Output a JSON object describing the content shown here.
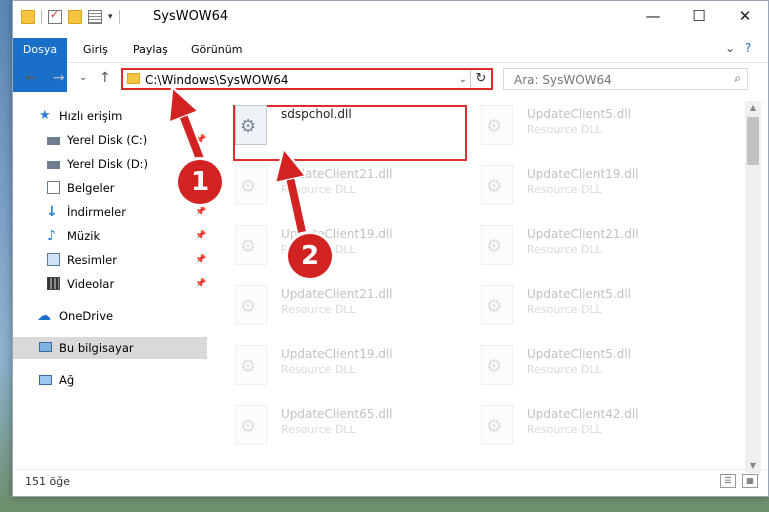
{
  "window": {
    "title": "SysWOW64"
  },
  "window_buttons": {
    "minimize": "—",
    "maximize": "☐",
    "close": "✕"
  },
  "ribbon": {
    "tabs": [
      "Dosya",
      "Giriş",
      "Paylaş",
      "Görünüm"
    ],
    "collapse_glyph": "⌄",
    "help_glyph": "?"
  },
  "navigation": {
    "back": "←",
    "forward": "→",
    "recent": "⌄",
    "up": "↑",
    "address": "C:\\Windows\\SysWOW64",
    "address_dropdown": "⌄",
    "refresh": "↻",
    "search_placeholder": "Ara: SysWOW64",
    "search_icon": "⌕"
  },
  "sidebar": {
    "items": [
      {
        "label": "Hızlı erişim",
        "icon": "star-icon",
        "pinned": false
      },
      {
        "label": "Yerel Disk (C:)",
        "icon": "drive-icon",
        "pinned": true
      },
      {
        "label": "Yerel Disk (D:)",
        "icon": "drive-icon",
        "pinned": false
      },
      {
        "label": "Belgeler",
        "icon": "documents-icon",
        "pinned": false
      },
      {
        "label": "İndirmeler",
        "icon": "download-icon",
        "pinned": true
      },
      {
        "label": "Müzik",
        "icon": "music-icon",
        "pinned": true
      },
      {
        "label": "Resimler",
        "icon": "pictures-icon",
        "pinned": true
      },
      {
        "label": "Videolar",
        "icon": "videos-icon",
        "pinned": true
      },
      {
        "label": "OneDrive",
        "icon": "cloud-icon",
        "pinned": false
      },
      {
        "label": "Bu bilgisayar",
        "icon": "computer-icon",
        "pinned": false,
        "selected": true
      },
      {
        "label": "Ağ",
        "icon": "network-icon",
        "pinned": false
      }
    ],
    "pin_glyph": "📌"
  },
  "files": [
    {
      "name": "sdspchol.dll",
      "type": "",
      "highlighted": true
    },
    {
      "name": "UpdateClient5.dll",
      "type": "Resource DLL"
    },
    {
      "name": "UpdateClient21.dll",
      "type": "Resource DLL"
    },
    {
      "name": "UpdateClient19.dll",
      "type": "Resource DLL"
    },
    {
      "name": "UpdateClient19.dll",
      "type": "Resource DLL"
    },
    {
      "name": "UpdateClient21.dll",
      "type": "Resource DLL"
    },
    {
      "name": "UpdateClient21.dll",
      "type": "Resource DLL"
    },
    {
      "name": "UpdateClient5.dll",
      "type": "Resource DLL"
    },
    {
      "name": "UpdateClient19.dll",
      "type": "Resource DLL"
    },
    {
      "name": "UpdateClient5.dll",
      "type": "Resource DLL"
    },
    {
      "name": "UpdateClient65.dll",
      "type": "Resource DLL"
    },
    {
      "name": "UpdateClient42.dll",
      "type": "Resource DLL"
    }
  ],
  "status": {
    "count": "151 öğe"
  },
  "annotations": {
    "step1": "1",
    "step2": "2",
    "accent": "#e02b2b",
    "badge_color": "#d32222"
  }
}
